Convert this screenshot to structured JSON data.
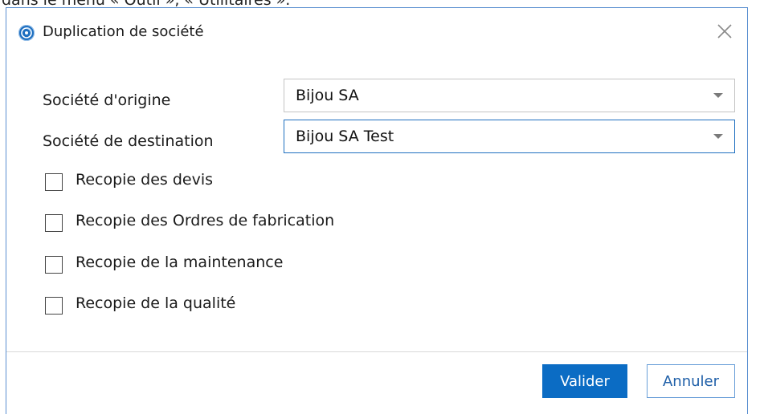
{
  "background": {
    "caption": "dans le menu « Outil », « Utilitaires »."
  },
  "dialog": {
    "title": "Duplication de société",
    "icons": {
      "app": "app-logo-icon",
      "close": "close-icon"
    },
    "fields": {
      "origin": {
        "label": "Société d'origine",
        "value": "Bijou SA"
      },
      "destination": {
        "label": "Société de destination",
        "value": "Bijou SA Test"
      }
    },
    "options": [
      {
        "label": "Recopie des devis",
        "checked": false
      },
      {
        "label": "Recopie des Ordres de fabrication",
        "checked": false
      },
      {
        "label": "Recopie de la maintenance",
        "checked": false
      },
      {
        "label": "Recopie de la qualité",
        "checked": false
      }
    ],
    "buttons": {
      "validate": "Valider",
      "cancel": "Annuler"
    },
    "colors": {
      "accent": "#0b6cc4",
      "border": "#5a8fd0"
    }
  }
}
